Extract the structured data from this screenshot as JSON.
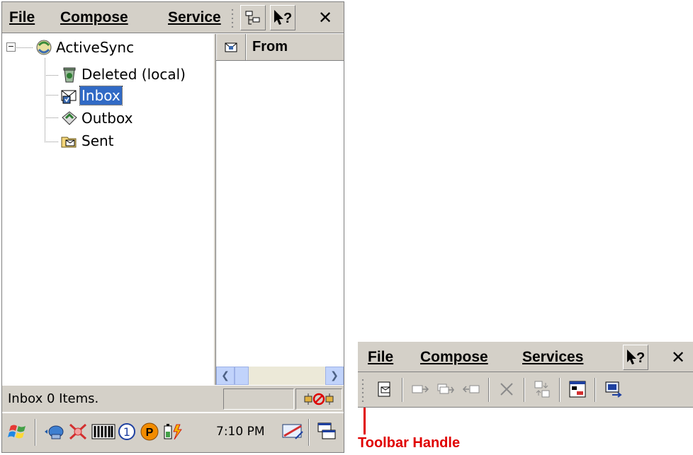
{
  "menu": {
    "file": "File",
    "compose": "Compose",
    "services": "Services",
    "services_truncated": "Service"
  },
  "tree": {
    "root": "ActiveSync",
    "expander": "−",
    "items": [
      {
        "label": "Deleted (local)",
        "icon": "recycle-bin-icon"
      },
      {
        "label": "Inbox",
        "icon": "inbox-icon",
        "selected": true
      },
      {
        "label": "Outbox",
        "icon": "outbox-icon"
      },
      {
        "label": "Sent",
        "icon": "sent-icon"
      }
    ]
  },
  "list": {
    "columns": [
      "From"
    ]
  },
  "status": {
    "text": "Inbox 0 Items."
  },
  "taskbar": {
    "clock": "7:10 PM"
  },
  "callout": {
    "label": "Toolbar Handle"
  },
  "colors": {
    "selection": "#316ac5",
    "annotation": "#e00000",
    "chrome": "#d4d0c8"
  }
}
